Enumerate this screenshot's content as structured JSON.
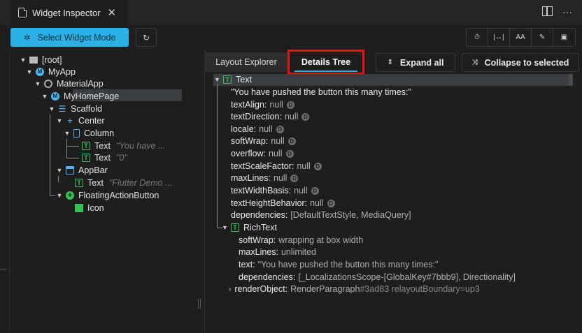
{
  "tab": {
    "title": "Widget Inspector",
    "close": "✕"
  },
  "toolbar": {
    "select_mode_label": "Select Widget Mode",
    "refresh_icon": "↻",
    "tools": [
      "⏱",
      "|↔|",
      "AA",
      "✎",
      "▣"
    ]
  },
  "tree": [
    {
      "label": "[root]",
      "sub": ""
    },
    {
      "label": "MyApp",
      "sub": ""
    },
    {
      "label": "MaterialApp",
      "sub": ""
    },
    {
      "label": "MyHomePage",
      "sub": ""
    },
    {
      "label": "Scaffold",
      "sub": ""
    },
    {
      "label": "Center",
      "sub": ""
    },
    {
      "label": "Column",
      "sub": ""
    },
    {
      "label": "Text",
      "sub": "\"You have ..."
    },
    {
      "label": "Text",
      "sub": "\"0\""
    },
    {
      "label": "AppBar",
      "sub": ""
    },
    {
      "label": "Text",
      "sub": "\"Flutter Demo ..."
    },
    {
      "label": "FloatingActionButton",
      "sub": ""
    },
    {
      "label": "Icon",
      "sub": ""
    }
  ],
  "details": {
    "tabs": {
      "layout_explorer": "Layout Explorer",
      "details_tree": "Details Tree"
    },
    "expand_all": "Expand all",
    "collapse_to_selected": "Collapse to selected",
    "root_label": "Text",
    "text_value": "\"You have pushed the button this many times:\"",
    "props": [
      {
        "k": "textAlign:",
        "v": "null"
      },
      {
        "k": "textDirection:",
        "v": "null"
      },
      {
        "k": "locale:",
        "v": "null"
      },
      {
        "k": "softWrap:",
        "v": "null"
      },
      {
        "k": "overflow:",
        "v": "null"
      },
      {
        "k": "textScaleFactor:",
        "v": "null"
      },
      {
        "k": "maxLines:",
        "v": "null"
      },
      {
        "k": "textWidthBasis:",
        "v": "null"
      },
      {
        "k": "textHeightBehavior:",
        "v": "null"
      }
    ],
    "badge": "D",
    "dependencies": {
      "k": "dependencies:",
      "v": "[DefaultTextStyle, MediaQuery]"
    },
    "richtext_label": "RichText",
    "rich_props": [
      {
        "k": "softWrap:",
        "v": "wrapping at box width"
      },
      {
        "k": "maxLines:",
        "v": "unlimited"
      },
      {
        "k": "text:",
        "v": "\"You have pushed the button this many times:\""
      },
      {
        "k": "dependencies:",
        "v": "[_LocalizationsScope-[GlobalKey#7bbb9], Directionality]"
      }
    ],
    "render_object": {
      "k": "renderObject:",
      "v": "RenderParagraph",
      "v2": "#3ad83 relayoutBoundary=up3"
    }
  }
}
